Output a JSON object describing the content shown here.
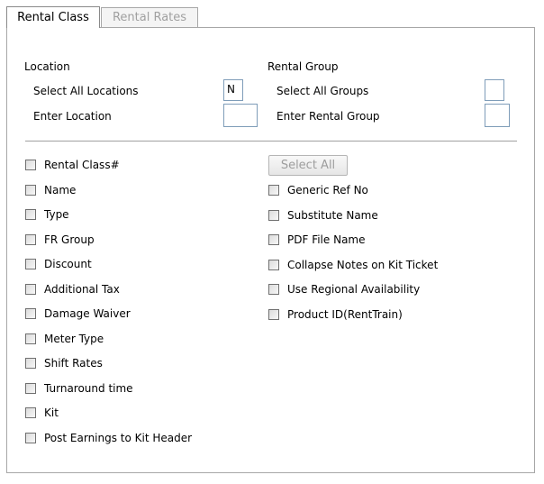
{
  "tabs": [
    {
      "label": "Rental Class",
      "active": true
    },
    {
      "label": "Rental Rates",
      "active": false
    }
  ],
  "location": {
    "heading": "Location",
    "select_all_label": "Select All Locations",
    "select_all_value": "N",
    "enter_label": "Enter Location",
    "enter_value": ""
  },
  "rental_group": {
    "heading": "Rental Group",
    "select_all_label": "Select All Groups",
    "select_all_value": "",
    "enter_label": "Enter Rental Group",
    "enter_value": ""
  },
  "select_all_button": "Select All",
  "left_checkboxes": [
    "Rental Class#",
    "Name",
    "Type",
    "FR Group",
    "Discount",
    "Additional Tax",
    "Damage Waiver",
    "Meter Type",
    "Shift Rates",
    "Turnaround time",
    "Kit",
    "Post Earnings to Kit Header"
  ],
  "right_checkboxes": [
    "Generic Ref No",
    "Substitute Name",
    "PDF File Name",
    "Collapse Notes on Kit Ticket",
    "Use Regional Availability",
    "Product ID(RentTrain)"
  ]
}
